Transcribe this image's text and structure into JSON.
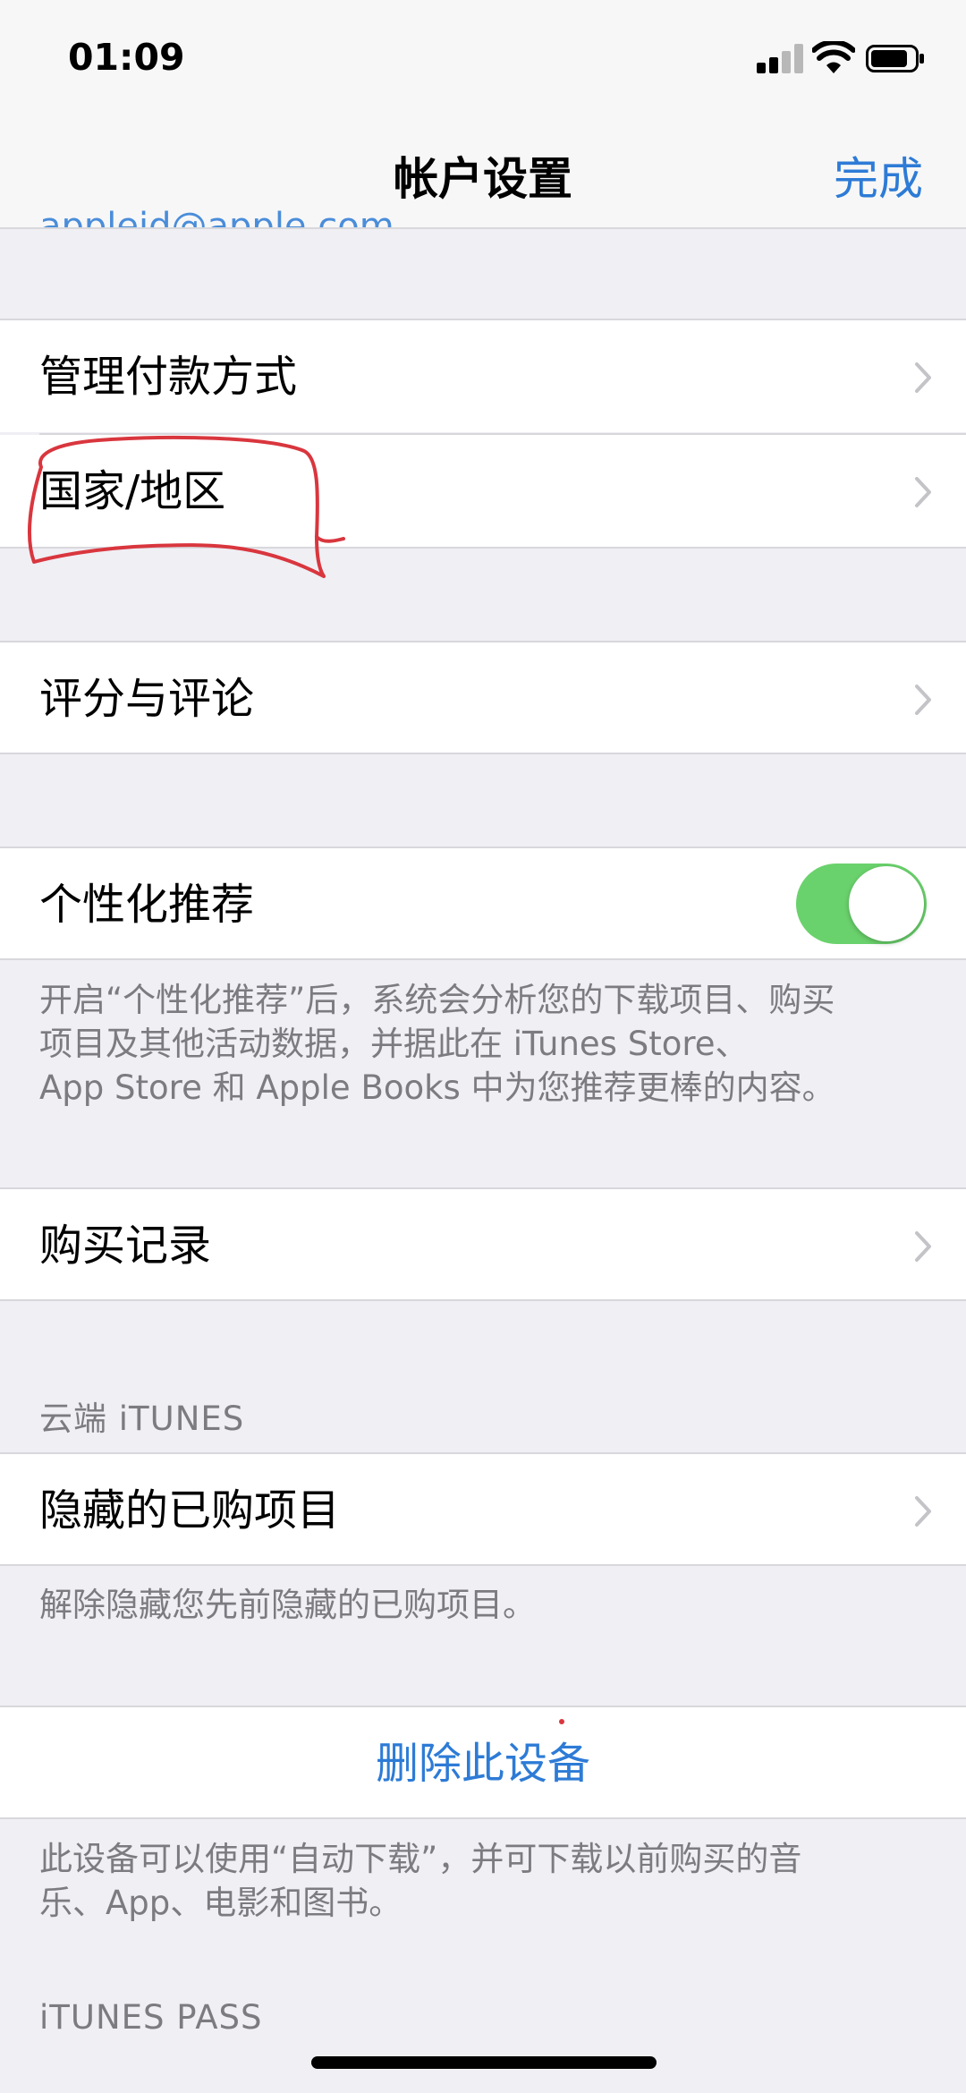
{
  "status_bar": {
    "time": "01:09",
    "signal_icon": "cellular-signal-icon",
    "wifi_icon": "wifi-icon",
    "battery_icon": "battery-icon"
  },
  "nav": {
    "title": "帐户设置",
    "done_label": "完成",
    "email_partial": "appleid@apple.com",
    "accent": "#2d7bd6"
  },
  "rows": {
    "manage_payment": "管理付款方式",
    "country_region": "国家/地区",
    "ratings_reviews": "评分与评论",
    "personalized": "个性化推荐",
    "purchase_history": "购买记录",
    "hidden_purchases": "隐藏的已购项目",
    "remove_device": "删除此设备"
  },
  "toggle": {
    "personalized_on": true,
    "on_color": "#6ad26c"
  },
  "footers": {
    "personalized_line1": "开启“个性化推荐”后，系统会分析您的下载项目、购买",
    "personalized_line2": "项目及其他活动数据，并据此在 iTunes Store、",
    "personalized_line3": "App Store 和 Apple Books 中为您推荐更棒的内容。",
    "hidden": "解除隐藏您先前隐藏的已购项目。",
    "device_line1": "此设备可以使用“自动下载”，并可下载以前购买的音",
    "device_line2": "乐、App、电影和图书。"
  },
  "section_headers": {
    "itunes_cloud": "云端 iTUNES",
    "itunes_pass": "iTUNES PASS"
  },
  "annotation": {
    "color": "#d9363e",
    "shape": "hand-drawn circle around 国家/地区"
  }
}
